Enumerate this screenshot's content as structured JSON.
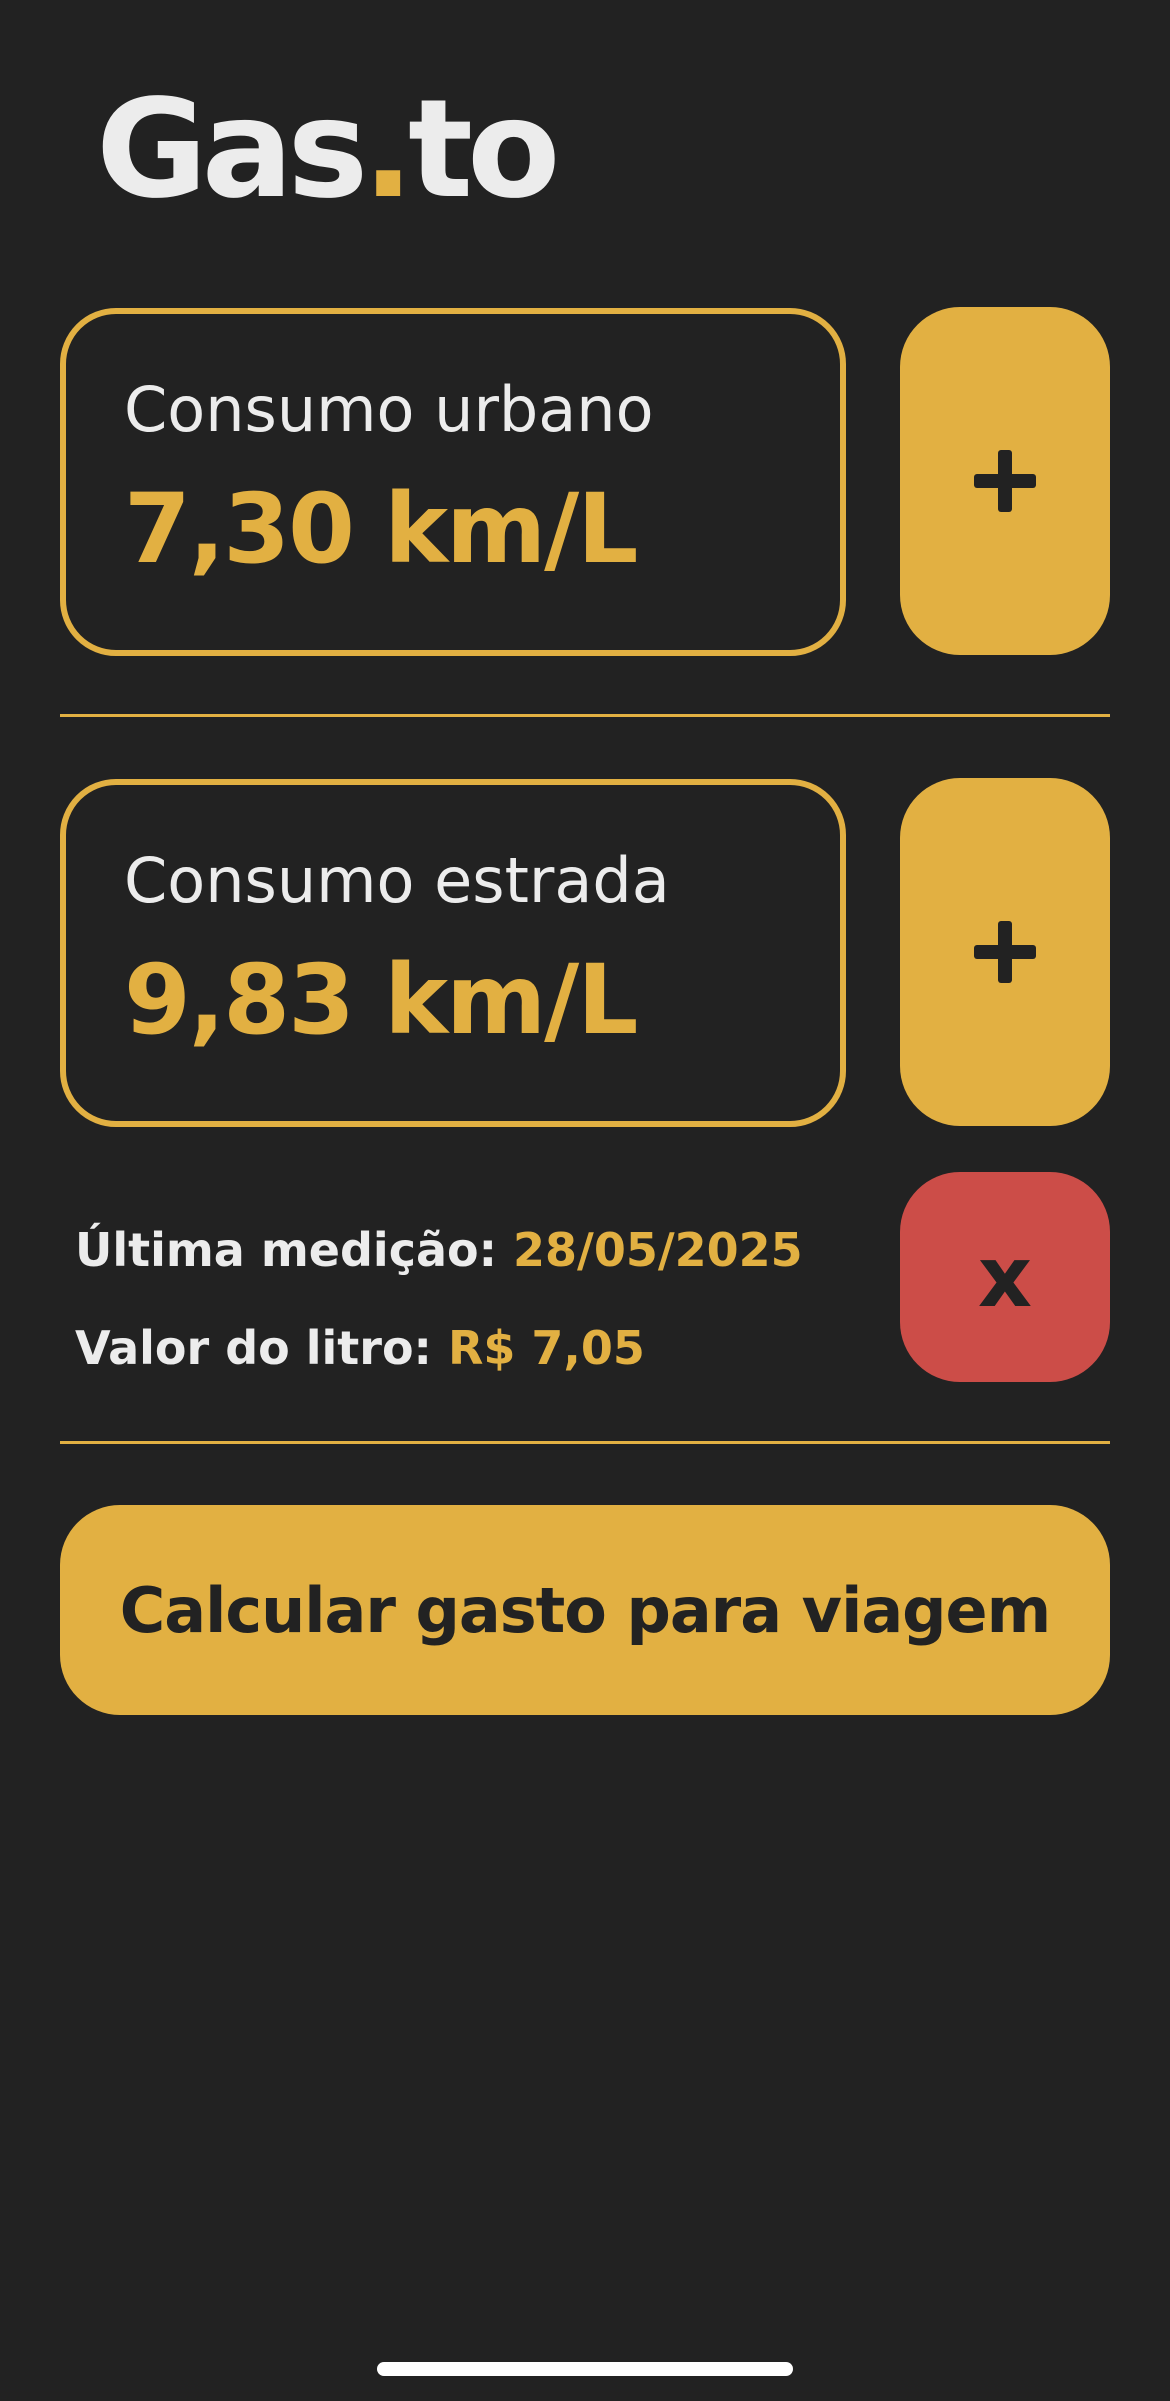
{
  "app": {
    "logo_main": "Gas",
    "logo_dot": ".",
    "logo_suffix": "to"
  },
  "urban": {
    "label": "Consumo urbano",
    "value": "7,30 km/L",
    "add_icon": "plus-icon"
  },
  "highway": {
    "label": "Consumo estrada",
    "value": "9,83 km/L",
    "add_icon": "plus-icon"
  },
  "info": {
    "last_measure_label": "Última medição:",
    "last_measure_value": "28/05/2025",
    "price_label": "Valor do litro:",
    "price_value": "R$ 7,05"
  },
  "delete_button": {
    "label": "x"
  },
  "cta": {
    "label": "Calcular gasto para viagem"
  },
  "colors": {
    "background": "#222222",
    "accent": "#e2b042",
    "danger": "#cc4d48",
    "text": "#ececec"
  }
}
